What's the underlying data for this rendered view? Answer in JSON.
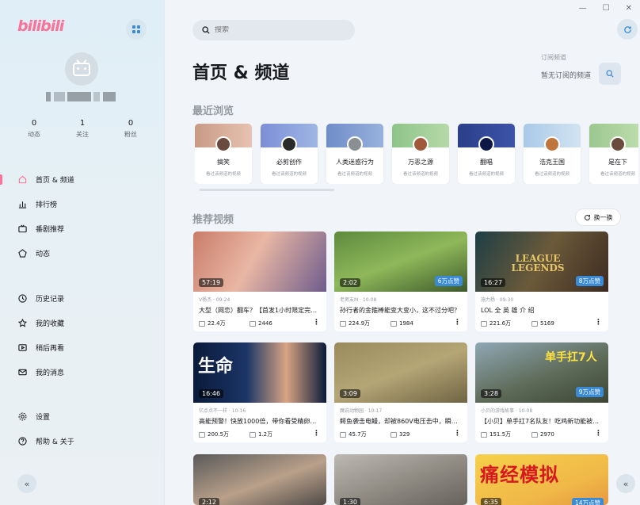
{
  "app": {
    "logo": "bilibili"
  },
  "profile": {
    "username_masked": ""
  },
  "stats": [
    {
      "value": "0",
      "label": "动态"
    },
    {
      "value": "1",
      "label": "关注"
    },
    {
      "value": "0",
      "label": "粉丝"
    }
  ],
  "nav_top": [
    {
      "id": "home",
      "label": "首页 & 频道",
      "active": true
    },
    {
      "id": "rank",
      "label": "排行榜"
    },
    {
      "id": "bangumi",
      "label": "番剧推荐"
    },
    {
      "id": "dynamic",
      "label": "动态"
    }
  ],
  "nav_mid": [
    {
      "id": "history",
      "label": "历史记录"
    },
    {
      "id": "favorites",
      "label": "我的收藏"
    },
    {
      "id": "later",
      "label": "稍后再看"
    },
    {
      "id": "messages",
      "label": "我的消息"
    }
  ],
  "nav_bottom": [
    {
      "id": "settings",
      "label": "设置"
    },
    {
      "id": "help",
      "label": "帮助 & 关于"
    }
  ],
  "search": {
    "placeholder": "搜索"
  },
  "main": {
    "title": "首页 & 频道",
    "subscribed_label": "订阅频道",
    "subscribed_empty": "暂无订阅的频道",
    "recent_title": "最近浏览",
    "recommended_title": "推荐视频",
    "swap_label": "换一换"
  },
  "recent": [
    {
      "name": "搞笑",
      "desc": "看过该频道的视频"
    },
    {
      "name": "必剪创作",
      "desc": "看过该频道的视频"
    },
    {
      "name": "人类迷惑行为",
      "desc": "看过该频道的视频"
    },
    {
      "name": "万恶之源",
      "desc": "看过该频道的视频"
    },
    {
      "name": "翻唱",
      "desc": "看过该频道的视频"
    },
    {
      "name": "浩克王国",
      "desc": "看过该频道的视频"
    },
    {
      "name": "是在下",
      "desc": "看过该频道的视频"
    }
  ],
  "videos": [
    {
      "duration": "57:19",
      "badge": "",
      "meta": "V杨杰 · 09-24",
      "title": "大型（网恋）翻车？【首发1小时限定完整版】",
      "views": "22.4万",
      "danmaku": "2446"
    },
    {
      "duration": "2:02",
      "badge": "6万点赞",
      "meta": "老男友M · 10-08",
      "title": "孙行者的金箍棒能变大变小，这不过分吧？",
      "views": "224.9万",
      "danmaku": "1984"
    },
    {
      "duration": "16:27",
      "badge": "8万点赞",
      "meta": "施力杨 · 09-30",
      "title": "LOL 全 英 雄 介 绍",
      "views": "221.6万",
      "danmaku": "5169"
    },
    {
      "duration": "16:46",
      "badge": "",
      "meta": "亿点点不一样 · 10-16",
      "title": "高能预警！快放1000倍，带你看受精卵发育过程",
      "views": "200.5万",
      "danmaku": "1.2万"
    },
    {
      "duration": "3:09",
      "badge": "",
      "meta": "魔说动物园 · 10-17",
      "title": "鳄鱼袭击电鳗，却被860V电压击中，瞬间...",
      "views": "45.7万",
      "danmaku": "329"
    },
    {
      "duration": "3:28",
      "badge": "9万点赞",
      "meta": "小贝的游戏故事 · 10-08",
      "title": "【小贝】单手扛7名队友！吃鸡新功能被我玩坏了",
      "views": "151.5万",
      "danmaku": "2970"
    },
    {
      "duration": "2:12",
      "badge": "",
      "meta": "",
      "title": "",
      "views": "",
      "danmaku": ""
    },
    {
      "duration": "1:30",
      "badge": "",
      "meta": "",
      "title": "",
      "views": "",
      "danmaku": ""
    },
    {
      "duration": "6:35",
      "badge": "14万点赞",
      "meta": "",
      "title": "",
      "views": "",
      "danmaku": ""
    }
  ],
  "thumb_text": [
    "生命",
    "单手扛7人",
    "痛经模拟",
    "LEAGUE LEGENDS"
  ],
  "colors": {
    "accent": "#fb7299",
    "blue": "#3a8bd6"
  }
}
